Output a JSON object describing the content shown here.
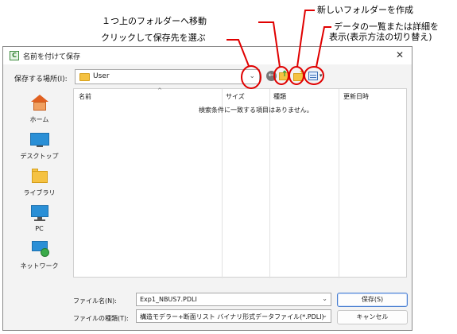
{
  "annotations": {
    "up_folder": "１つ上のフォルダーへ移動",
    "new_folder": "新しいフォルダーを作成",
    "view_line1": "データの一覧または詳細を",
    "view_line2": "表示(表示方法の切り替え)",
    "click_select": "クリックして保存先を選ぶ",
    "callout_color": "#e00000"
  },
  "dialog": {
    "title": "名前を付けて保存",
    "close_glyph": "✕",
    "app_icon_glyph": "C",
    "lookin": {
      "label": "保存する場所(I):",
      "value": "User",
      "dropdown_glyph": "⌄"
    },
    "toolbar": {
      "back_glyph": "←",
      "up_glyph": "↑",
      "new_glyph": "✦",
      "view_dropdown_glyph": "▾"
    },
    "places": [
      {
        "label": "ホーム",
        "icon": "home-icon"
      },
      {
        "label": "デスクトップ",
        "icon": "desktop-icon"
      },
      {
        "label": "ライブラリ",
        "icon": "library-icon"
      },
      {
        "label": "PC",
        "icon": "pc-icon"
      },
      {
        "label": "ネットワーク",
        "icon": "network-icon"
      }
    ],
    "filelist": {
      "columns": [
        "名前",
        "サイズ",
        "種類",
        "更新日時"
      ],
      "sort_glyph": "^",
      "empty_message": "検索条件に一致する項目はありません。"
    },
    "filename": {
      "label": "ファイル名(N):",
      "value": "Exp1_NBUS7.PDLI"
    },
    "filetype": {
      "label": "ファイルの種類(T):",
      "value": "構造モデラー+断面リスト バイナリ形式データファイル(*.PDLI)"
    },
    "buttons": {
      "save": "保存(S)",
      "cancel": "キャンセル"
    },
    "accent_color": "#4a7fd0"
  }
}
